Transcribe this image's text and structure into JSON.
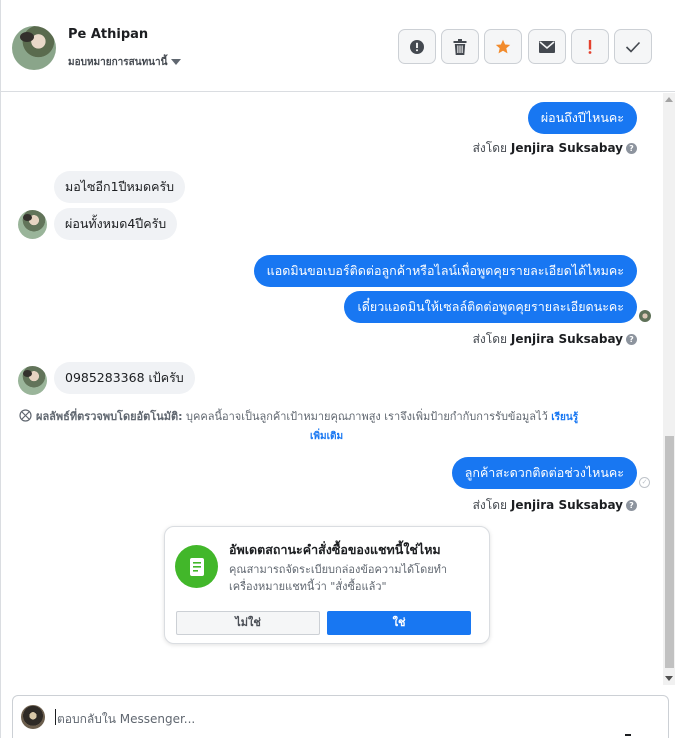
{
  "header": {
    "name": "Pe Athipan",
    "assign_label": "มอบหมายการสนทนานี้"
  },
  "toolbar": [
    {
      "name": "spam-button",
      "icon": "alert-circle-icon",
      "color": "#444950"
    },
    {
      "name": "delete-button",
      "icon": "trash-icon",
      "color": "#444950"
    },
    {
      "name": "star-button",
      "icon": "star-icon",
      "color": "#f28b2c"
    },
    {
      "name": "mark-unread-button",
      "icon": "envelope-icon",
      "color": "#444950"
    },
    {
      "name": "follow-up-button",
      "icon": "exclamation-icon",
      "color": "#e4412e"
    },
    {
      "name": "done-button",
      "icon": "checkmark-icon",
      "color": "#444950"
    }
  ],
  "messages": {
    "m1": "ผ่อนถึงปีไหนคะ",
    "sent1_prefix": "ส่งโดย",
    "sent1_name": "Jenjira Suksabay",
    "m2": "มอไซอีก1ปีหมดครับ",
    "m3": "ผ่อนทั้งหมด4ปีครับ",
    "m4": "แอดมินขอเบอร์ติดต่อลูกค้าหรือไลน์เพื่อพูดคุยรายละเอียดได้ไหมคะ",
    "m5": "เดี๋ยวแอดมินให้เซลล์ติดต่อพูดคุยรายละเอียดนะคะ",
    "sent2_prefix": "ส่งโดย",
    "sent2_name": "Jenjira Suksabay",
    "m6": "0985283368 เป้ครับ",
    "m7": "ลูกค้าสะดวกติดต่อช่วงไหนคะ",
    "sent3_prefix": "ส่งโดย",
    "sent3_name": "Jenjira Suksabay"
  },
  "ai_note": {
    "label": "ผลลัพธ์ที่ตรวจพบโดยอัตโนมัติ:",
    "text": "บุคคลนี้อาจเป็นลูกค้าเป้าหมายคุณภาพสูง เราจึงเพิ่มป้ายกำกับการรับข้อมูลไว้",
    "learn_1": "เรียนรู้",
    "learn_2": "เพิ่มเติม"
  },
  "card": {
    "title": "อัพเดตสถานะคำสั่งซื้อของแชทนี้ใช่ไหม",
    "desc": "คุณสามารถจัดระเบียบกล่องข้อความได้โดยทำเครื่องหมายแชทนี้ว่า \"สั่งซื้อแล้ว\"",
    "no_label": "ไม่ใช่",
    "yes_label": "ใช่"
  },
  "composer": {
    "placeholder": "ตอบกลับใน Messenger..."
  },
  "colors": {
    "brand_blue": "#1877f2",
    "success_green": "#42b72a",
    "incoming_bg": "#f0f2f5"
  }
}
